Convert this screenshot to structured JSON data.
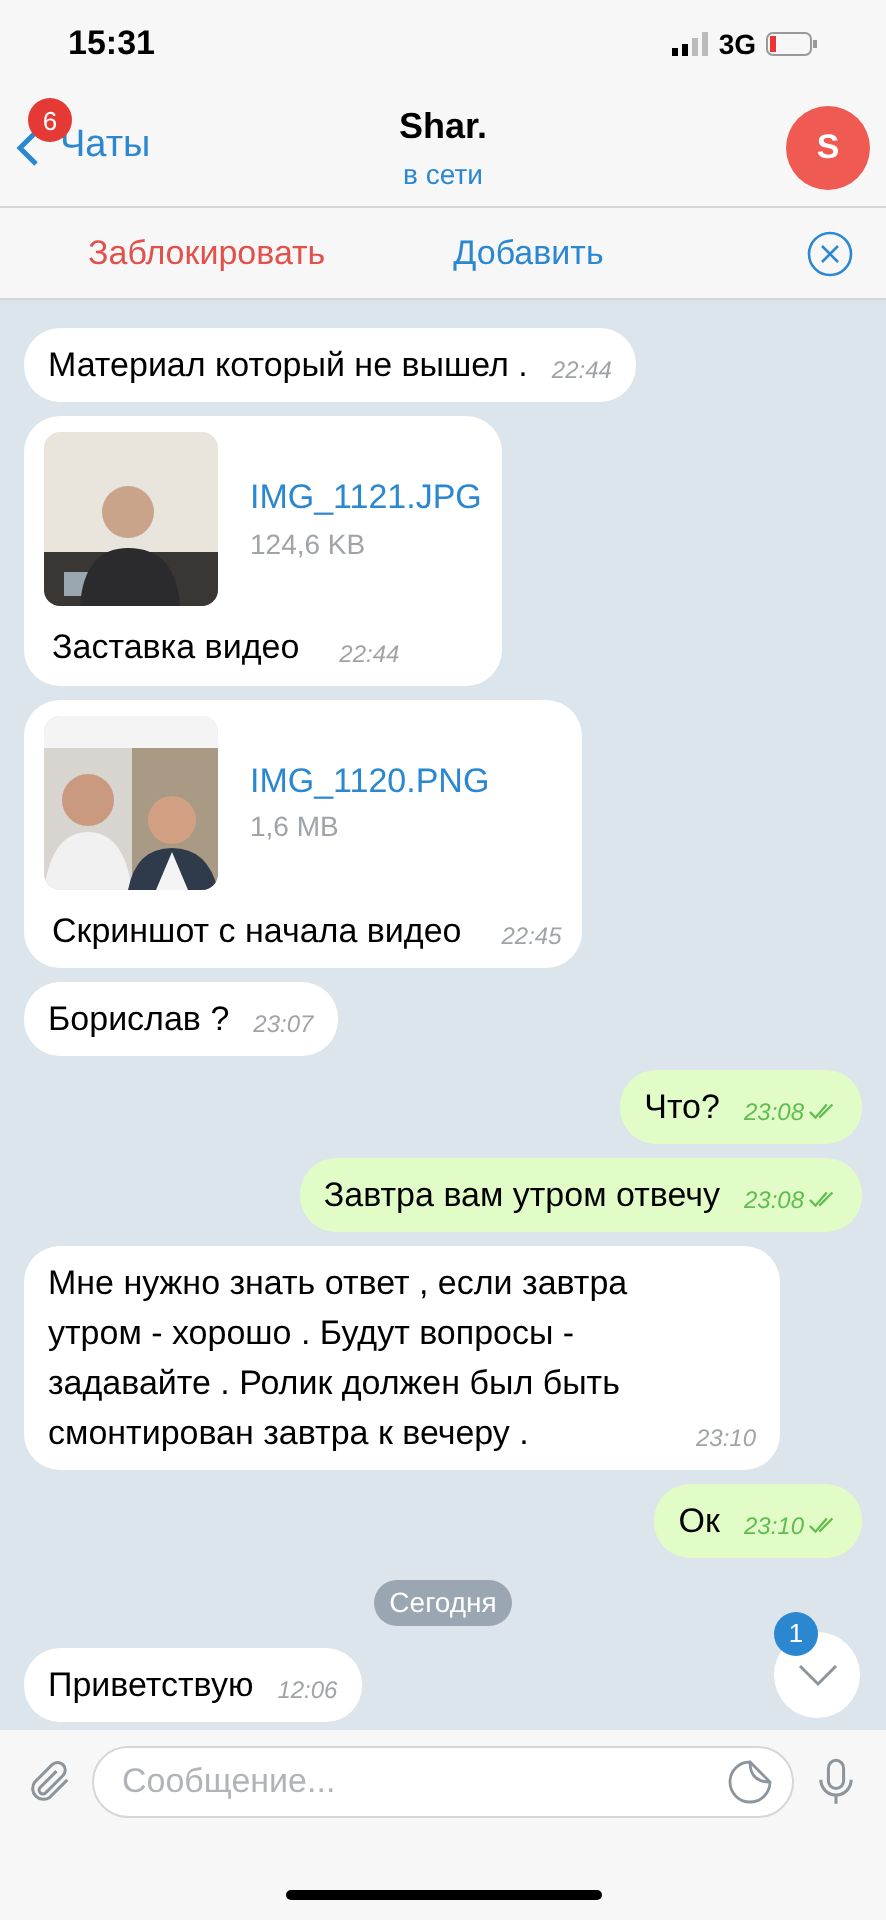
{
  "status_bar": {
    "time": "15:31",
    "network": "3G"
  },
  "header": {
    "back_label": "Чаты",
    "unread_badge": "6",
    "title": "Shar.",
    "subtitle": "в сети",
    "avatar_letter": "S"
  },
  "action_bar": {
    "block": "Заблокировать",
    "add": "Добавить"
  },
  "messages": [
    {
      "kind": "text",
      "outgoing": false,
      "text": "Материал который не вышел .",
      "time": "22:44"
    },
    {
      "kind": "file",
      "outgoing": false,
      "file_name": "IMG_1121.JPG",
      "file_size": "124,6 KB",
      "text": "Заставка видео",
      "time": "22:44"
    },
    {
      "kind": "file",
      "outgoing": false,
      "file_name": "IMG_1120.PNG",
      "file_size": "1,6 MB",
      "text": "Скриншот с начала видео",
      "time": "22:45"
    },
    {
      "kind": "text",
      "outgoing": false,
      "text": "Борислав ?",
      "time": "23:07"
    },
    {
      "kind": "text",
      "outgoing": true,
      "read": true,
      "text": "Что?",
      "time": "23:08"
    },
    {
      "kind": "text",
      "outgoing": true,
      "read": true,
      "text": "Завтра вам утром отвечу",
      "time": "23:08"
    },
    {
      "kind": "text",
      "outgoing": false,
      "text": "Мне нужно знать ответ , если завтра утром - хорошо . Будут вопросы - задавайте . Ролик должен был быть смонтирован завтра к вечеру .",
      "time": "23:10"
    },
    {
      "kind": "text",
      "outgoing": true,
      "read": true,
      "text": "Ок",
      "time": "23:10"
    },
    {
      "kind": "date",
      "text": "Сегодня"
    },
    {
      "kind": "text",
      "outgoing": false,
      "text": "Приветствую",
      "time": "12:06"
    }
  ],
  "scroll_down": {
    "badge": "1"
  },
  "composer": {
    "placeholder": "Сообщение..."
  }
}
